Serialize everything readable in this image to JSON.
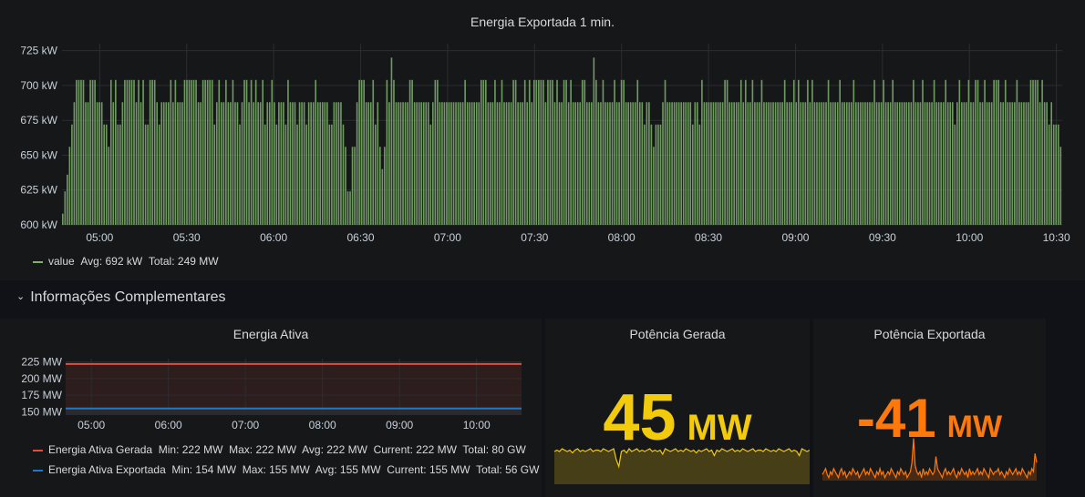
{
  "main_panel": {
    "title": "Energia Exportada 1 min.",
    "legend": {
      "series": "value",
      "avg_label": "Avg:",
      "avg": "692 kW",
      "total_label": "Total:",
      "total": "249 MW",
      "color": "#7eb26d"
    }
  },
  "row": {
    "title": "Informações Complementares"
  },
  "energia_ativa": {
    "title": "Energia Ativa",
    "legend": [
      {
        "name": "Energia Ativa Gerada",
        "stats": "Min: 222 MW  Max: 222 MW  Avg: 222 MW  Current: 222 MW  Total: 80 GW",
        "color": "#e24d42"
      },
      {
        "name": "Energia Ativa Exportada",
        "stats": "Min: 154 MW  Max: 155 MW  Avg: 155 MW  Current: 155 MW  Total: 56 GW",
        "color": "#1f78c1"
      }
    ]
  },
  "potencia_gerada": {
    "title": "Potência Gerada",
    "value": "45",
    "unit": "MW",
    "color": "#f2cc0c"
  },
  "potencia_exportada": {
    "title": "Potência Exportada",
    "value": "-41",
    "unit": "MW",
    "color": "#ff780a"
  },
  "chart_data": [
    {
      "type": "bar",
      "title": "Energia Exportada 1 min.",
      "y_unit": "kW",
      "ylim": [
        600,
        730
      ],
      "yticks": [
        "600 kW",
        "625 kW",
        "650 kW",
        "675 kW",
        "700 kW",
        "725 kW"
      ],
      "xticks": [
        "05:00",
        "05:30",
        "06:00",
        "06:30",
        "07:00",
        "07:30",
        "08:00",
        "08:30",
        "09:00",
        "09:30",
        "10:00",
        "10:30"
      ],
      "x_range": [
        "04:47",
        "10:32"
      ],
      "series": [
        {
          "name": "value",
          "color": "#7eb26d",
          "values": [
            608,
            624,
            636,
            656,
            672,
            688,
            704,
            704,
            704,
            704,
            688,
            688,
            704,
            704,
            704,
            688,
            688,
            688,
            672,
            672,
            656,
            704,
            688,
            704,
            672,
            672,
            688,
            704,
            704,
            704,
            704,
            704,
            688,
            704,
            688,
            704,
            672,
            672,
            704,
            704,
            704,
            688,
            672,
            688,
            688,
            688,
            688,
            704,
            688,
            704,
            688,
            688,
            688,
            704,
            704,
            704,
            704,
            704,
            704,
            688,
            688,
            704,
            704,
            704,
            704,
            704,
            672,
            688,
            704,
            688,
            688,
            704,
            688,
            688,
            704,
            688,
            688,
            672,
            688,
            704,
            704,
            688,
            704,
            688,
            704,
            688,
            688,
            704,
            672,
            688,
            688,
            704,
            688,
            672,
            688,
            688,
            688,
            672,
            704,
            688,
            688,
            688,
            672,
            688,
            688,
            688,
            672,
            688,
            688,
            688,
            704,
            688,
            688,
            688,
            688,
            688,
            672,
            672,
            688,
            688,
            688,
            688,
            672,
            656,
            624,
            624,
            656,
            656,
            688,
            704,
            704,
            704,
            688,
            688,
            688,
            704,
            672,
            688,
            656,
            640,
            656,
            704,
            688,
            720,
            704,
            688,
            688,
            688,
            688,
            688,
            688,
            704,
            704,
            688,
            688,
            688,
            688,
            688,
            688,
            688,
            672,
            688,
            704,
            704,
            688,
            688,
            688,
            688,
            688,
            688,
            688,
            688,
            688,
            688,
            688,
            704,
            688,
            688,
            688,
            688,
            688,
            688,
            704,
            704,
            704,
            688,
            688,
            688,
            704,
            688,
            688,
            704,
            688,
            688,
            688,
            688,
            704,
            704,
            688,
            688,
            688,
            704,
            688,
            704,
            688,
            704,
            704,
            704,
            704,
            704,
            688,
            704,
            704,
            704,
            688,
            704,
            688,
            688,
            704,
            704,
            688,
            704,
            688,
            688,
            688,
            688,
            704,
            704,
            688,
            688,
            688,
            720,
            704,
            688,
            688,
            704,
            688,
            688,
            688,
            688,
            704,
            688,
            688,
            704,
            704,
            688,
            688,
            688,
            688,
            688,
            704,
            688,
            688,
            672,
            688,
            688,
            672,
            656,
            672,
            672,
            672,
            688,
            704,
            688,
            688,
            688,
            688,
            688,
            688,
            688,
            688,
            688,
            688,
            688,
            672,
            688,
            688,
            672,
            704,
            688,
            688,
            688,
            688,
            688,
            688,
            688,
            688,
            688,
            704,
            704,
            688,
            688,
            688,
            688,
            688,
            704,
            688,
            704,
            688,
            688,
            704,
            688,
            688,
            688,
            704,
            688,
            688,
            688,
            688,
            688,
            688,
            688,
            688,
            688,
            704,
            688,
            688,
            688,
            704,
            688,
            704,
            688,
            688,
            688,
            704,
            688,
            704,
            688,
            688,
            688,
            688,
            688,
            688,
            704,
            688,
            688,
            688,
            688,
            704,
            688,
            688,
            688,
            688,
            688,
            704,
            688,
            688,
            688,
            688,
            688,
            688,
            688,
            688,
            704,
            688,
            688,
            688,
            704,
            688,
            688,
            688,
            704,
            688,
            688,
            688,
            688,
            688,
            688,
            688,
            688,
            704,
            688,
            688,
            688,
            704,
            688,
            688,
            688,
            688,
            704,
            688,
            688,
            688,
            688,
            704,
            688,
            688,
            688,
            672,
            688,
            704,
            688,
            688,
            688,
            704,
            688,
            688,
            704,
            704,
            688,
            688,
            704,
            688,
            688,
            688,
            704,
            704,
            704,
            688,
            688,
            704,
            688,
            688,
            688,
            688,
            704,
            688,
            688,
            688,
            688,
            688,
            704,
            704,
            704,
            704,
            688,
            704,
            688,
            688,
            672,
            688,
            672,
            672,
            672,
            656
          ]
        }
      ]
    },
    {
      "type": "line",
      "title": "Energia Ativa",
      "y_unit": "MW",
      "ylim": [
        145,
        230
      ],
      "yticks": [
        "150 MW",
        "175 MW",
        "200 MW",
        "225 MW"
      ],
      "xticks": [
        "05:00",
        "06:00",
        "07:00",
        "08:00",
        "09:00",
        "10:00"
      ],
      "series": [
        {
          "name": "Energia Ativa Gerada",
          "color": "#e24d42",
          "value": 222
        },
        {
          "name": "Energia Ativa Exportada",
          "color": "#1f78c1",
          "value": 155
        }
      ]
    },
    {
      "type": "area",
      "title": "Potência Gerada",
      "color": "#f2cc0c",
      "values": [
        44,
        45,
        44,
        46,
        45,
        44,
        45,
        43,
        45,
        46,
        44,
        45,
        44,
        45,
        46,
        44,
        45,
        45,
        44,
        46,
        45,
        44,
        45,
        46,
        38,
        33,
        44,
        45,
        43,
        46,
        44,
        45,
        46,
        44,
        45,
        44,
        45,
        46,
        44,
        45,
        44,
        45,
        42,
        46,
        45,
        44,
        45,
        46,
        44,
        45,
        44,
        46,
        45,
        44,
        45,
        43,
        45,
        44,
        45,
        46,
        44,
        45,
        41,
        45,
        44,
        46,
        45,
        44,
        45,
        46,
        44,
        45,
        44,
        46,
        45,
        44,
        45,
        46,
        44,
        45,
        45,
        44,
        46,
        45,
        44,
        45,
        44,
        46,
        45,
        44,
        45,
        46,
        44,
        45,
        44,
        41,
        46,
        45,
        44,
        45
      ]
    },
    {
      "type": "area",
      "title": "Potência Exportada",
      "color": "#ff780a",
      "values": [
        34,
        35,
        36,
        34,
        33,
        35,
        34,
        36,
        35,
        34,
        33,
        35,
        36,
        34,
        35,
        33,
        34,
        35,
        34,
        36,
        35,
        34,
        35,
        33,
        34,
        35,
        36,
        34,
        35,
        34,
        36,
        35,
        34,
        33,
        35,
        34,
        36,
        34,
        35,
        33,
        34,
        35,
        34,
        36,
        35,
        34,
        33,
        35,
        34,
        36,
        35,
        34,
        35,
        33,
        34,
        35,
        38,
        46,
        37,
        35,
        34,
        35,
        33,
        36,
        34,
        35,
        34,
        36,
        35,
        34,
        35,
        40,
        36,
        35,
        34,
        33,
        35,
        36,
        34,
        35,
        34,
        35,
        36,
        34,
        33,
        35,
        34,
        36,
        35,
        34,
        35,
        33,
        36,
        34,
        35,
        34,
        35,
        36,
        34,
        35,
        34,
        36,
        35,
        34,
        33,
        36,
        35,
        34,
        35,
        35,
        36,
        34,
        35,
        34,
        33,
        35,
        34,
        36,
        35,
        34,
        35,
        36,
        34,
        35,
        34,
        36,
        35,
        34,
        33,
        35,
        34,
        36,
        35,
        41,
        38
      ]
    }
  ]
}
